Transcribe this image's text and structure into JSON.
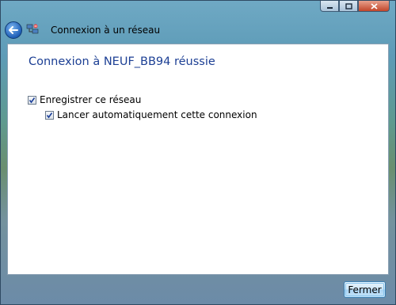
{
  "window": {
    "title": "Connexion à un réseau",
    "controls": {
      "minimize": "minimize-icon",
      "maximize": "maximize-icon",
      "close": "close-icon"
    },
    "back_icon": "back-arrow-icon",
    "app_icon": "network-icon"
  },
  "main": {
    "heading": "Connexion à NEUF_BB94 réussie",
    "options": [
      {
        "label": "Enregistrer ce réseau",
        "checked": true
      },
      {
        "label": "Lancer automatiquement cette connexion",
        "checked": true
      }
    ]
  },
  "footer": {
    "close_label": "Fermer"
  },
  "colors": {
    "heading": "#1c3f94",
    "accent": "#3c7fb1"
  }
}
